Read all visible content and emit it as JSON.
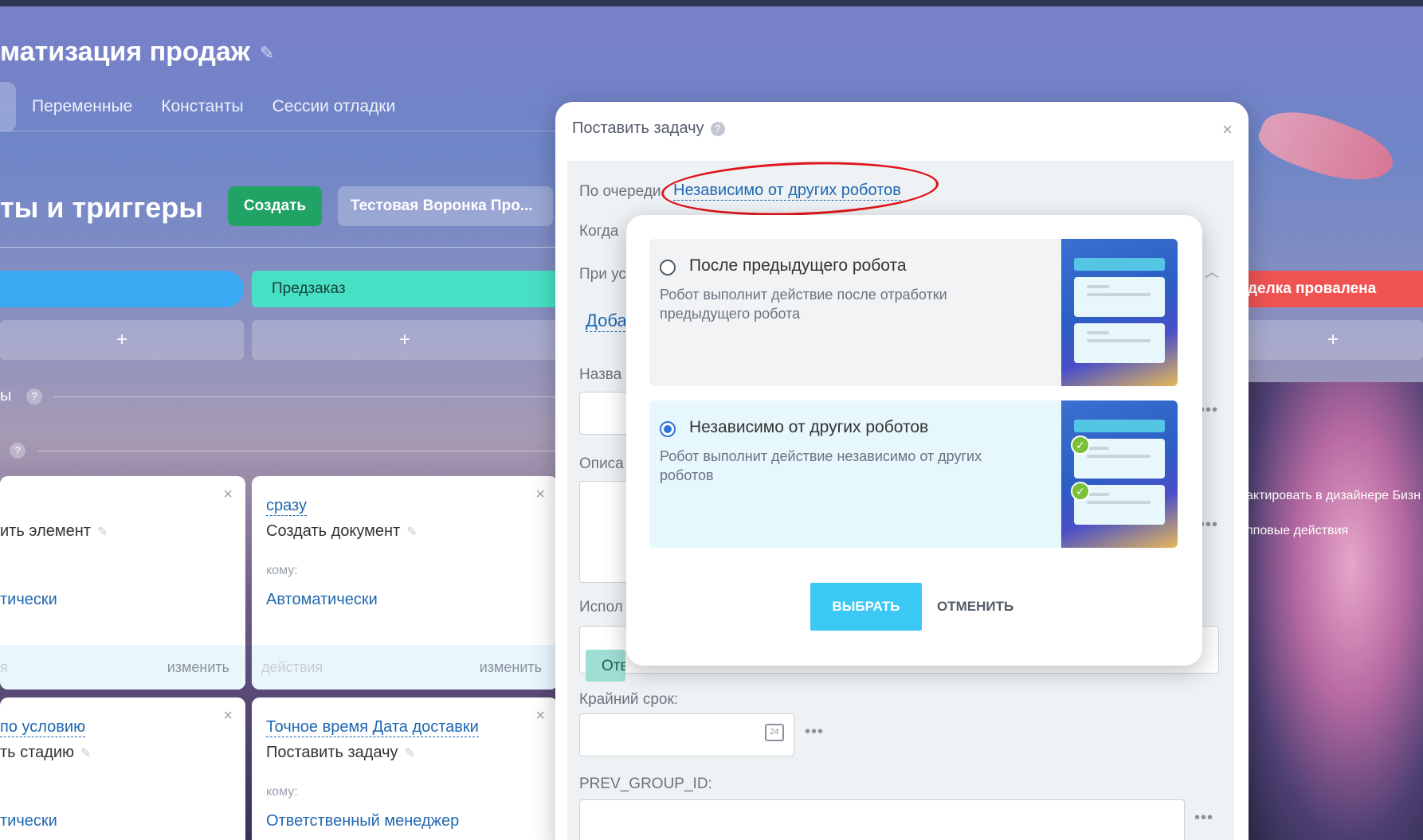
{
  "page": {
    "title": "матизация продаж"
  },
  "tabs": [
    "Переменные",
    "Константы",
    "Сессии отладки"
  ],
  "section": {
    "title": "ты и триггеры",
    "create_label": "Создать",
    "funnel_label": "Тестовая Воронка Про..."
  },
  "stages": {
    "green": "Предзаказ",
    "red": "делка провалена"
  },
  "rows": {
    "row1": "ы",
    "row2": ""
  },
  "cards": [
    {
      "when": "",
      "title": "ить элемент",
      "to_label": "",
      "to_value": "тически",
      "foot_left": "я",
      "foot_right": "изменить"
    },
    {
      "when": "сразу",
      "title": "Создать документ",
      "to_label": "кому:",
      "to_value": "Автоматически",
      "foot_left": "действия",
      "foot_right": "изменить"
    },
    {
      "when": "по условию",
      "title": "ть стадию",
      "to_label": "",
      "to_value": "тически"
    },
    {
      "when": "Точное время Дата доставки",
      "title": "Поставить задачу",
      "to_label": "кому:",
      "to_value": "Ответственный менеджер"
    }
  ],
  "side": {
    "edit_designer": "актировать в дизайнере Бизн",
    "group_actions": "пповые действия"
  },
  "dialog": {
    "title": "Поставить задачу",
    "queue_label": "По очереди",
    "queue_value": "Независимо от других роботов",
    "when_label": "Когда",
    "cond_label": "При ус",
    "add_link": "Доба",
    "name_label": "Назва",
    "desc_label": "Описа",
    "exec_label": "Испол",
    "responsible_tag": "Отв",
    "deadline_label": "Крайний срок:",
    "calendar_day": "24",
    "prev_group_label": "PREV_GROUP_ID:"
  },
  "popup": {
    "option1": {
      "title": "После предыдущего робота",
      "desc": "Робот выполнит действие после отработки предыдущего робота",
      "selected": false
    },
    "option2": {
      "title": "Независимо от других роботов",
      "desc": "Робот выполнит действие независимо от других роботов",
      "selected": true
    },
    "choose_label": "ВЫБРАТЬ",
    "cancel_label": "ОТМЕНИТЬ"
  }
}
